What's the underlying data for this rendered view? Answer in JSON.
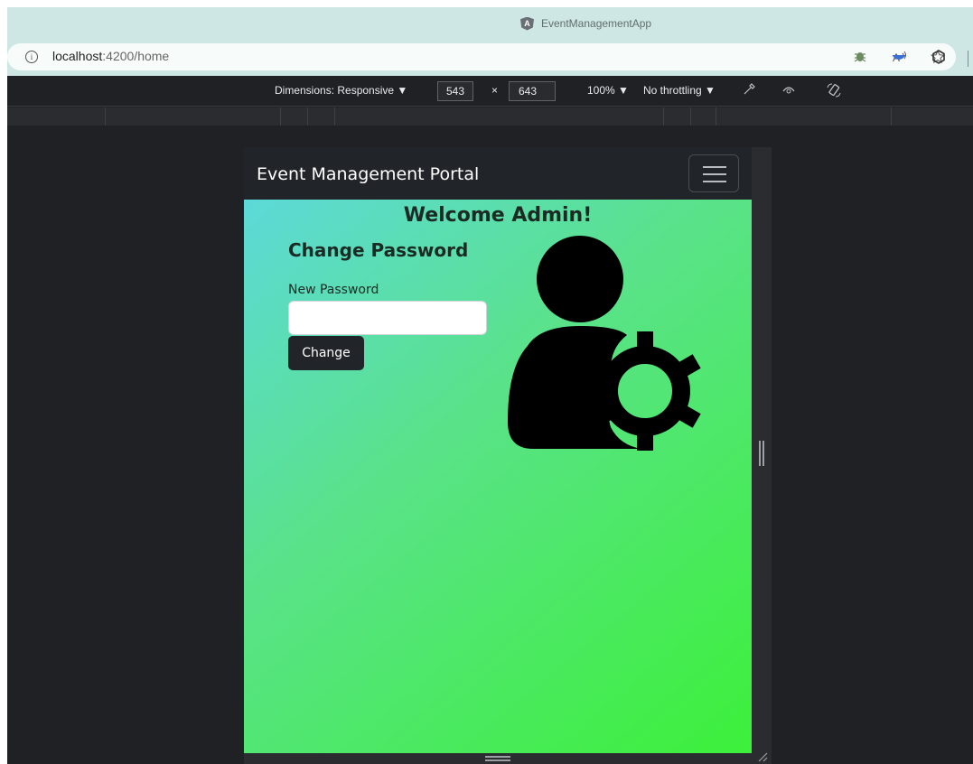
{
  "browser": {
    "window_title": "EventManagementApp",
    "url_host": "localhost",
    "url_path": ":4200/home"
  },
  "devtools": {
    "dimensions_label": "Dimensions: Responsive ▼",
    "width": "543",
    "times": "×",
    "height": "643",
    "zoom": "100% ▼",
    "throttling": "No throttling ▼"
  },
  "app": {
    "brand": "Event Management Portal",
    "welcome": "Welcome Admin!",
    "form_title": "Change Password",
    "new_password_label": "New Password",
    "new_password_value": "",
    "change_button": "Change"
  },
  "icons": {
    "info": "info-icon",
    "read_aloud": "read-aloud-icon",
    "favorite": "star-icon",
    "extension": "bug-icon",
    "collections": "collection-icon",
    "copilot": "copilot-icon",
    "hamburger": "hamburger-icon",
    "user_settings": "user-gear-icon"
  },
  "colors": {
    "navbar": "#212529",
    "gradient_start": "#5cd9d9",
    "gradient_end": "#3cf03a"
  }
}
